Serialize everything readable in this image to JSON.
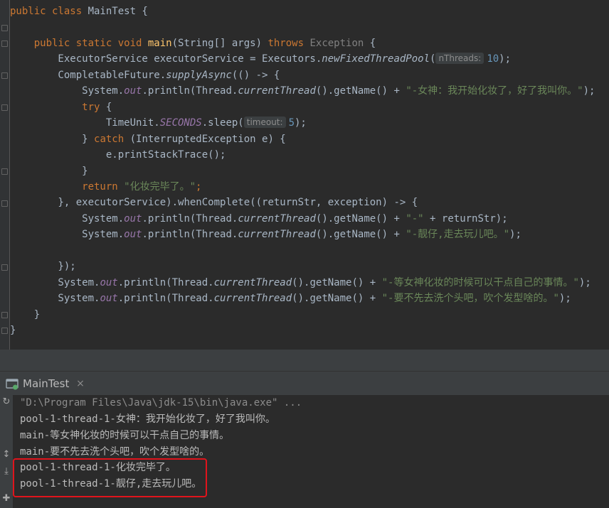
{
  "editor": {
    "lines": [
      {
        "parts": [
          {
            "t": "public class ",
            "c": "kw"
          },
          {
            "t": "MainTest {",
            "c": ""
          }
        ]
      },
      {
        "parts": []
      },
      {
        "parts": [
          {
            "t": "    public static void ",
            "c": "kw"
          },
          {
            "t": "main",
            "c": "fn"
          },
          {
            "t": "(String[] args) ",
            "c": ""
          },
          {
            "t": "throws ",
            "c": "kw"
          },
          {
            "t": "Exception",
            "c": "ann"
          },
          {
            "t": " {",
            "c": ""
          }
        ]
      },
      {
        "parts": [
          {
            "t": "        ExecutorService executorService = Executors.",
            "c": ""
          },
          {
            "t": "newFixedThreadPool",
            "c": "it"
          },
          {
            "t": "(",
            "c": ""
          },
          {
            "t": "nThreads:",
            "c": "hint"
          },
          {
            "t": "10",
            "c": "num"
          },
          {
            "t": ");",
            "c": ""
          }
        ]
      },
      {
        "parts": [
          {
            "t": "        CompletableFuture.",
            "c": ""
          },
          {
            "t": "supplyAsync",
            "c": "it"
          },
          {
            "t": "(() -> {",
            "c": ""
          }
        ]
      },
      {
        "parts": [
          {
            "t": "            System.",
            "c": ""
          },
          {
            "t": "out",
            "c": "static"
          },
          {
            "t": ".println(Thread.",
            "c": ""
          },
          {
            "t": "currentThread",
            "c": "it"
          },
          {
            "t": "().getName() + ",
            "c": ""
          },
          {
            "t": "\"-女神：我开始化妆了，好了我叫你。\"",
            "c": "str"
          },
          {
            "t": ");",
            "c": ""
          }
        ]
      },
      {
        "parts": [
          {
            "t": "            try ",
            "c": "kw"
          },
          {
            "t": "{",
            "c": ""
          }
        ]
      },
      {
        "parts": [
          {
            "t": "                TimeUnit.",
            "c": ""
          },
          {
            "t": "SECONDS",
            "c": "static"
          },
          {
            "t": ".sleep(",
            "c": ""
          },
          {
            "t": "timeout:",
            "c": "hint"
          },
          {
            "t": "5",
            "c": "num"
          },
          {
            "t": ");",
            "c": ""
          }
        ]
      },
      {
        "parts": [
          {
            "t": "            } ",
            "c": ""
          },
          {
            "t": "catch ",
            "c": "kw"
          },
          {
            "t": "(InterruptedException e) {",
            "c": ""
          }
        ]
      },
      {
        "parts": [
          {
            "t": "                e.printStackTrace();",
            "c": ""
          }
        ]
      },
      {
        "parts": [
          {
            "t": "            }",
            "c": ""
          }
        ]
      },
      {
        "parts": [
          {
            "t": "            return ",
            "c": "kw"
          },
          {
            "t": "\"化妆完毕了。\"",
            "c": "str"
          },
          {
            "t": ";",
            "c": "kw"
          }
        ]
      },
      {
        "parts": [
          {
            "t": "        }, ",
            "c": ""
          },
          {
            "t": "executorService",
            "c": ""
          },
          {
            "t": ").whenComplete((returnStr, exception) -> {",
            "c": ""
          }
        ]
      },
      {
        "parts": [
          {
            "t": "            System.",
            "c": ""
          },
          {
            "t": "out",
            "c": "static"
          },
          {
            "t": ".println(Thread.",
            "c": ""
          },
          {
            "t": "currentThread",
            "c": "it"
          },
          {
            "t": "().getName() + ",
            "c": ""
          },
          {
            "t": "\"-\"",
            "c": "str"
          },
          {
            "t": " + returnStr);",
            "c": ""
          }
        ]
      },
      {
        "parts": [
          {
            "t": "            System.",
            "c": ""
          },
          {
            "t": "out",
            "c": "static"
          },
          {
            "t": ".println(Thread.",
            "c": ""
          },
          {
            "t": "currentThread",
            "c": "it"
          },
          {
            "t": "().getName() + ",
            "c": ""
          },
          {
            "t": "\"-靓仔,走去玩儿吧。\"",
            "c": "str"
          },
          {
            "t": ");",
            "c": ""
          }
        ]
      },
      {
        "parts": []
      },
      {
        "parts": [
          {
            "t": "        });",
            "c": ""
          }
        ]
      },
      {
        "parts": [
          {
            "t": "        System.",
            "c": ""
          },
          {
            "t": "out",
            "c": "static"
          },
          {
            "t": ".println(Thread.",
            "c": ""
          },
          {
            "t": "currentThread",
            "c": "it"
          },
          {
            "t": "().getName() + ",
            "c": ""
          },
          {
            "t": "\"-等女神化妆的时候可以干点自己的事情。\"",
            "c": "str"
          },
          {
            "t": ");",
            "c": ""
          }
        ]
      },
      {
        "parts": [
          {
            "t": "        System.",
            "c": ""
          },
          {
            "t": "out",
            "c": "static"
          },
          {
            "t": ".println(Thread.",
            "c": ""
          },
          {
            "t": "currentThread",
            "c": "it"
          },
          {
            "t": "().getName() + ",
            "c": ""
          },
          {
            "t": "\"-要不先去洗个头吧，吹个发型啥的。\"",
            "c": "str"
          },
          {
            "t": ");",
            "c": ""
          }
        ]
      },
      {
        "parts": [
          {
            "t": "    }",
            "c": ""
          }
        ]
      },
      {
        "parts": [
          {
            "t": "}",
            "c": ""
          }
        ]
      }
    ]
  },
  "run_panel": {
    "tab_label": "MainTest",
    "close_glyph": "×",
    "output": [
      "\"D:\\Program Files\\Java\\jdk-15\\bin\\java.exe\" ...",
      "pool-1-thread-1-女神：我开始化妆了，好了我叫你。",
      "main-等女神化妆的时候可以干点自己的事情。",
      "main-要不先去洗个头吧，吹个发型啥的。",
      "pool-1-thread-1-化妆完毕了。",
      "pool-1-thread-1-靓仔,走去玩儿吧。"
    ]
  },
  "icons": {
    "run_icon": "run-config-icon",
    "rerun": "↻",
    "soft_wrap": "↕",
    "pin": "✚"
  },
  "colors": {
    "highlight_box": "#e0141c",
    "keyword": "#cc7832",
    "string": "#6a8759",
    "number": "#6897bb"
  }
}
